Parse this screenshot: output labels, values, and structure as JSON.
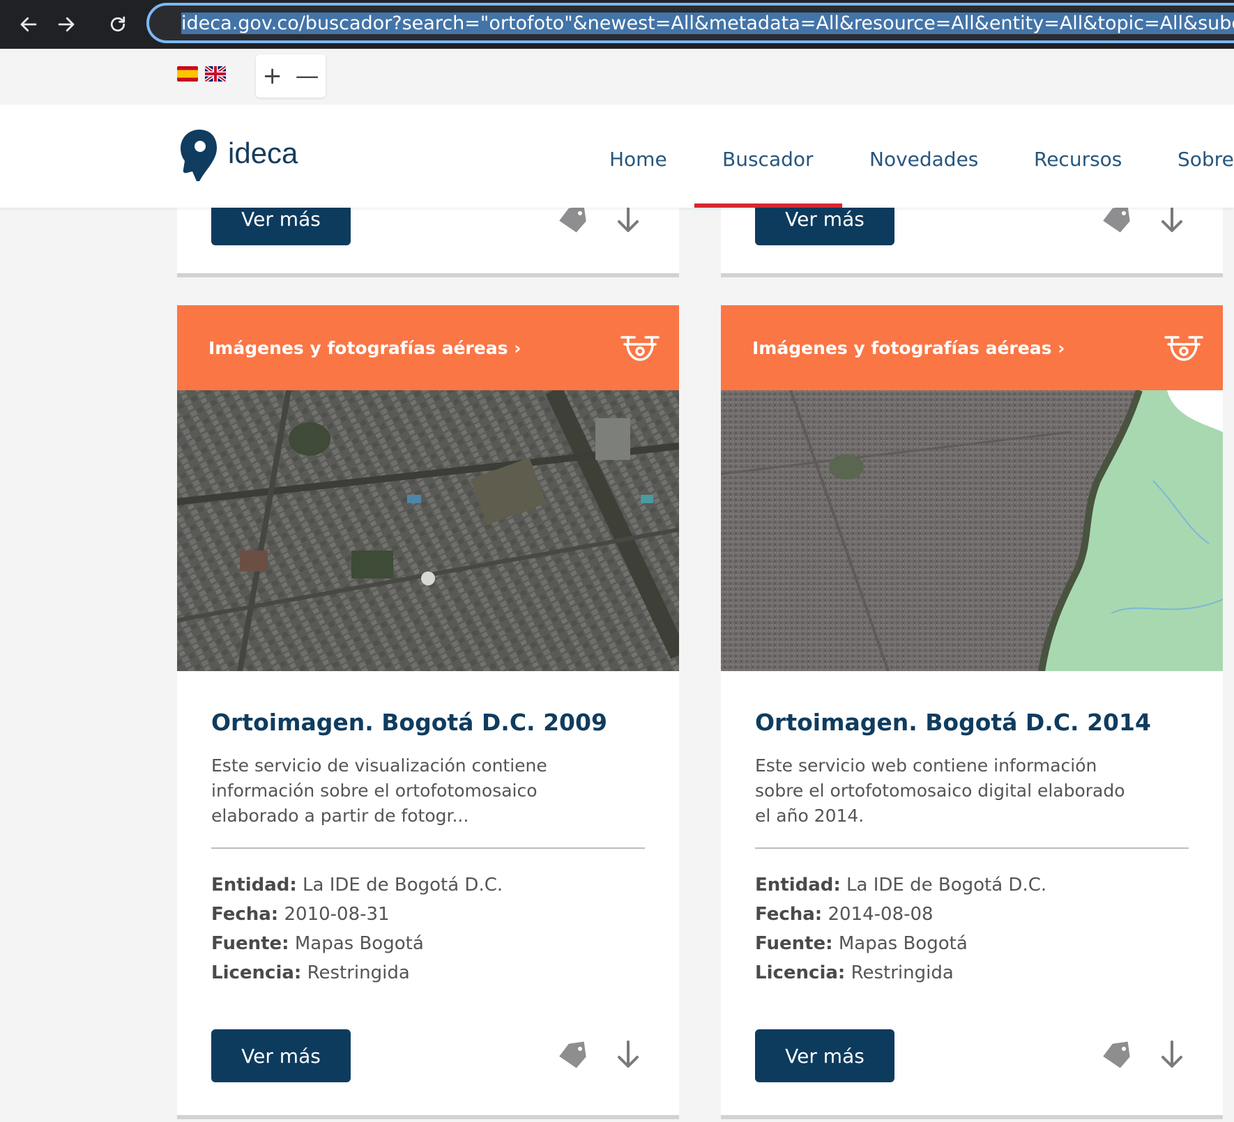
{
  "browser": {
    "url": "ideca.gov.co/buscador?search=\"ortofoto\"&newest=All&metadata=All&resource=All&entity=All&topic=All&subcat"
  },
  "utility": {
    "zoom_in": "+",
    "zoom_out": "—"
  },
  "header": {
    "logo_text": "ideca",
    "menu": [
      "Home",
      "Buscador",
      "Novedades",
      "Recursos",
      "Sobre"
    ],
    "active": "Buscador"
  },
  "top_cards": [
    {
      "button": "Ver más"
    },
    {
      "button": "Ver más"
    }
  ],
  "cards": [
    {
      "category": "Imágenes y fotografías aéreas ›",
      "title": "Ortoimagen. Bogotá D.C. 2009",
      "description": "Este servicio de visualización contiene información sobre el ortofotomosaico elaborado a partir de fotogr...",
      "entidad_label": "Entidad:",
      "entidad": "La IDE de Bogotá D.C.",
      "fecha_label": "Fecha:",
      "fecha": "2010-08-31",
      "fuente_label": "Fuente:",
      "fuente": "Mapas Bogotá",
      "licencia_label": "Licencia:",
      "licencia": "Restringida",
      "button": "Ver más"
    },
    {
      "category": "Imágenes y fotografías aéreas ›",
      "title": "Ortoimagen. Bogotá D.C. 2014",
      "description": "Este servicio web contiene información sobre el ortofotomosaico digital elaborado el año 2014.",
      "entidad_label": "Entidad:",
      "entidad": "La IDE de Bogotá D.C.",
      "fecha_label": "Fecha:",
      "fecha": "2014-08-08",
      "fuente_label": "Fuente:",
      "fuente": "Mapas Bogotá",
      "licencia_label": "Licencia:",
      "licencia": "Restringida",
      "button": "Ver más"
    }
  ],
  "icons": {
    "back": "arrow-left-icon",
    "forward": "arrow-right-icon",
    "reload": "reload-icon",
    "lock": "lock-icon",
    "category": "drone-icon",
    "tag": "tag-icon",
    "download": "download-arrow-icon"
  },
  "colors": {
    "brand": "#0d3b5e",
    "accent_orange": "#fb7645",
    "active_underline": "#d62830"
  }
}
